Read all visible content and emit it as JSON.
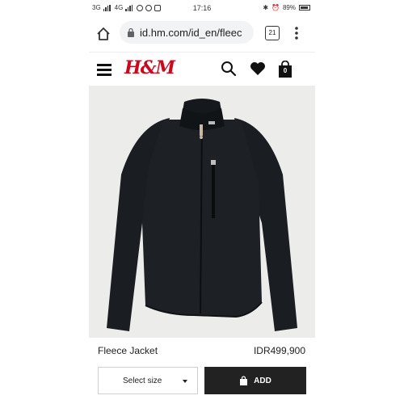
{
  "status_bar": {
    "signal1": "3G",
    "signal2": "4G",
    "time": "17:16",
    "battery": "89%"
  },
  "browser": {
    "url": "id.hm.com/id_en/fleec",
    "tab_count": "21"
  },
  "site": {
    "logo": "H&M",
    "bag_count": "0"
  },
  "product": {
    "name": "Fleece Jacket",
    "price": "IDR499,900",
    "size_select_label": "Select size",
    "add_label": "ADD"
  },
  "colors": {
    "brand": "#cc071e",
    "button": "#222222",
    "image_bg": "#ececeb"
  },
  "icons": [
    "home-icon",
    "lock-icon",
    "tabs-icon",
    "more-vert-icon",
    "menu-icon",
    "search-icon",
    "heart-icon",
    "bag-icon",
    "caret-down-icon"
  ]
}
